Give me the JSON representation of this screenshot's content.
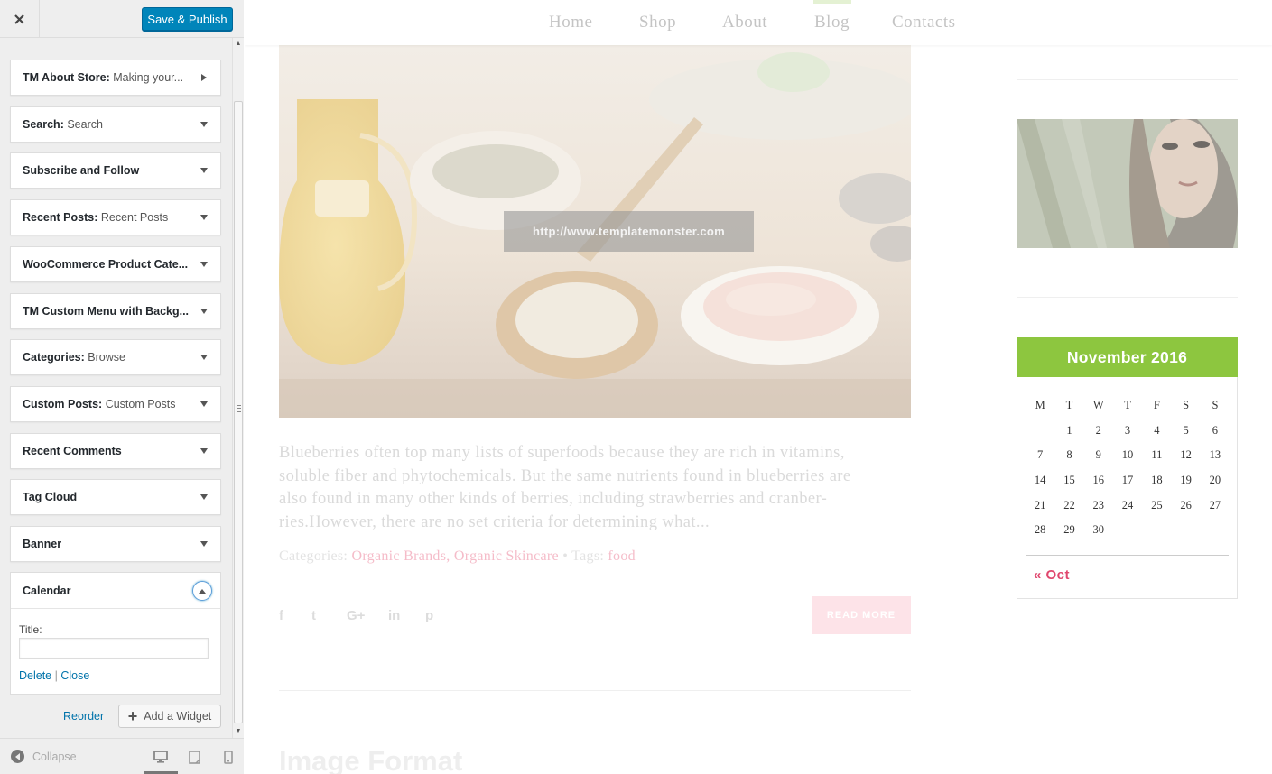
{
  "sidebar": {
    "close_icon": "close-icon",
    "publish_label": "Save & Publish",
    "widgets": [
      {
        "title": "TM About Store",
        "subtitle": ": Making your...",
        "expanded": false
      },
      {
        "title": "Search",
        "subtitle": ": Search",
        "expanded": false
      },
      {
        "title": "Subscribe and Follow",
        "subtitle": "",
        "expanded": false
      },
      {
        "title": "Recent Posts",
        "subtitle": ": Recent Posts",
        "expanded": false
      },
      {
        "title": "WooCommerce Product Cate...",
        "subtitle": "",
        "expanded": false
      },
      {
        "title": "TM Custom Menu with Backg...",
        "subtitle": "",
        "expanded": false
      },
      {
        "title": "Categories",
        "subtitle": ": Browse",
        "expanded": false
      },
      {
        "title": "Custom Posts",
        "subtitle": ": Custom Posts",
        "expanded": false
      },
      {
        "title": "Recent Comments",
        "subtitle": "",
        "expanded": false
      },
      {
        "title": "Tag Cloud",
        "subtitle": "",
        "expanded": false
      },
      {
        "title": "Banner",
        "subtitle": "",
        "expanded": false
      }
    ],
    "calendar_widget": {
      "title": "Calendar",
      "field_label": "Title:",
      "field_value": "",
      "delete_label": "Delete",
      "separator": "|",
      "close_label": "Close"
    },
    "reorder_label": "Reorder",
    "add_widget_label": "Add a Widget",
    "collapse_label": "Collapse",
    "devices": [
      "desktop",
      "tablet",
      "mobile"
    ],
    "active_device": "desktop",
    "accent_color": "#0085ba"
  },
  "preview": {
    "nav": [
      "Home",
      "Shop",
      "About",
      "Blog",
      "Contacts"
    ],
    "active_nav": "Blog",
    "hero_link": "http://www.templatemonster.com",
    "excerpt_lines": [
      "Blueberries often top many lists of superfoods because they are rich in vitamins,",
      "soluble fiber and phytochemicals. But the same nutrients found in blueberries are",
      "also found in many other kinds of berries, including strawberries and cranber-",
      "ries.However, there are no set criteria for determining what..."
    ],
    "meta": {
      "categories_label": "Categories:",
      "categories": [
        "Organic Brands",
        "Organic Skincare"
      ],
      "separator": "•",
      "tags_label": "Tags:",
      "tags": [
        "food"
      ]
    },
    "social_icons": [
      "facebook-icon",
      "twitter-icon",
      "google-plus-icon",
      "linkedin-icon",
      "pinterest-icon"
    ],
    "social_glyphs": [
      "f",
      "t",
      "G+",
      "in",
      "p"
    ],
    "read_more_label": "READ MORE",
    "next_post_title": "Image Format",
    "calendar": {
      "title": "November 2016",
      "weekdays": [
        "M",
        "T",
        "W",
        "T",
        "F",
        "S",
        "S"
      ],
      "weeks": [
        [
          "",
          "1",
          "2",
          "3",
          "4",
          "5",
          "6"
        ],
        [
          "7",
          "8",
          "9",
          "10",
          "11",
          "12",
          "13"
        ],
        [
          "14",
          "15",
          "16",
          "17",
          "18",
          "19",
          "20"
        ],
        [
          "21",
          "22",
          "23",
          "24",
          "25",
          "26",
          "27"
        ],
        [
          "28",
          "29",
          "30",
          "",
          "",
          "",
          ""
        ]
      ],
      "prev_label": "« Oct",
      "header_color": "#8dc63f",
      "link_color": "#e0476e"
    }
  }
}
